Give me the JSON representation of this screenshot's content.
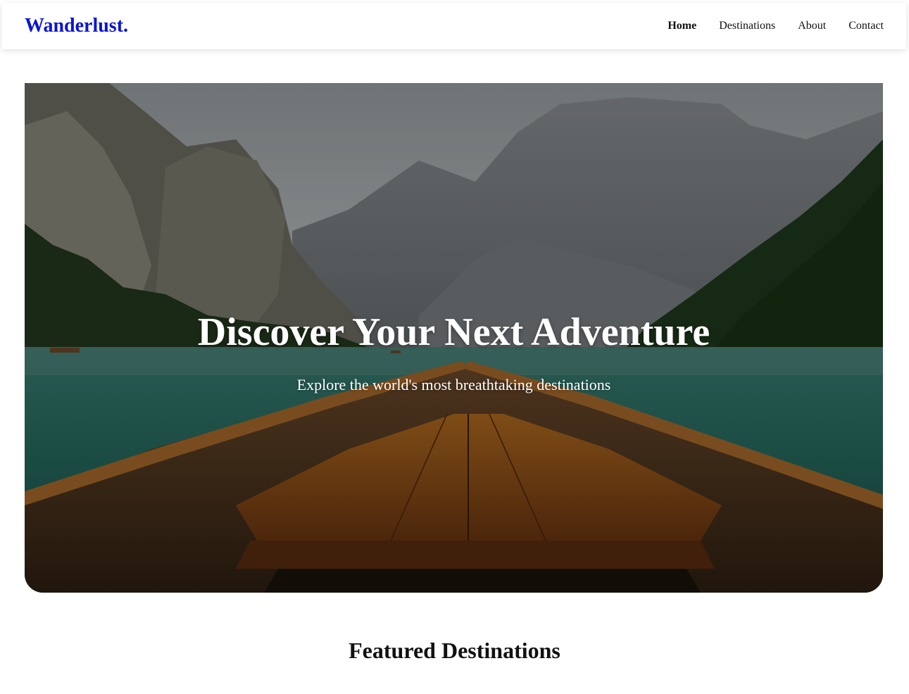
{
  "header": {
    "logo": "Wanderlust.",
    "nav": [
      {
        "label": "Home",
        "active": true
      },
      {
        "label": "Destinations",
        "active": false
      },
      {
        "label": "About",
        "active": false
      },
      {
        "label": "Contact",
        "active": false
      }
    ]
  },
  "hero": {
    "title": "Discover Your Next Adventure",
    "subtitle": "Explore the world's most breathtaking destinations",
    "image": "mountain-lake-boat-photo"
  },
  "featured": {
    "title": "Featured Destinations"
  },
  "colors": {
    "brand": "#0a14d6",
    "text": "#111111",
    "background": "#ffffff"
  }
}
